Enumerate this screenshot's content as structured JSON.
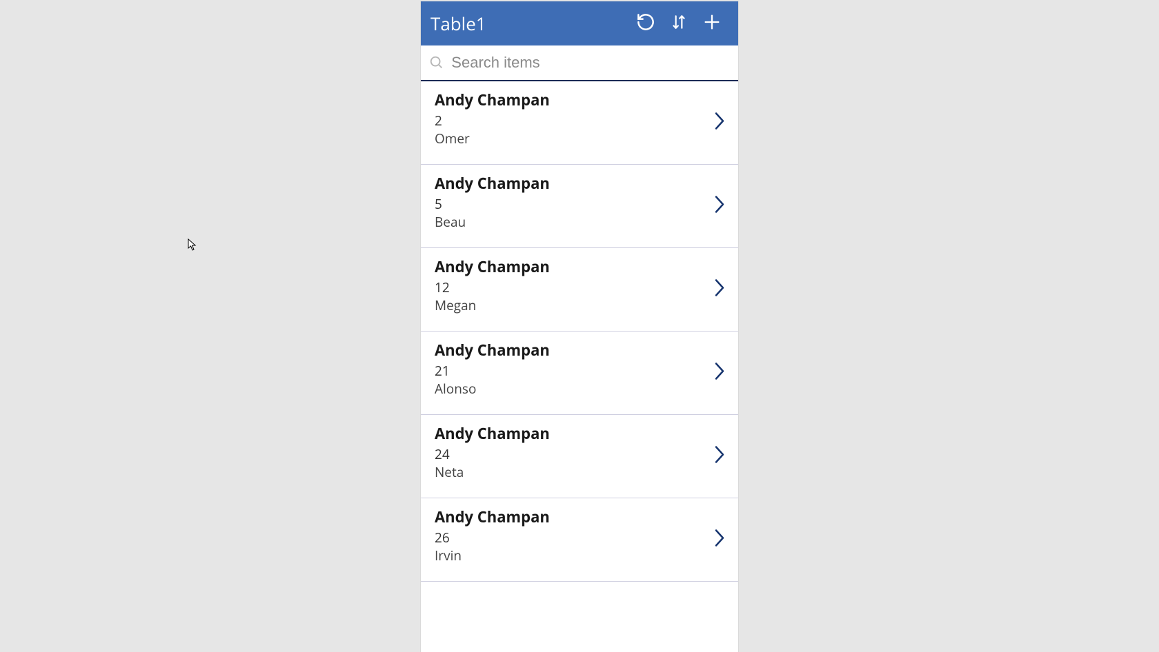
{
  "colors": {
    "accent": "#3e6db5",
    "chevron": "#16346e"
  },
  "header": {
    "title": "Table1"
  },
  "search": {
    "placeholder": "Search items",
    "value": ""
  },
  "items": [
    {
      "title": "Andy Champan",
      "number": "2",
      "name": "Omer"
    },
    {
      "title": "Andy Champan",
      "number": "5",
      "name": "Beau"
    },
    {
      "title": "Andy Champan",
      "number": "12",
      "name": "Megan"
    },
    {
      "title": "Andy Champan",
      "number": "21",
      "name": "Alonso"
    },
    {
      "title": "Andy Champan",
      "number": "24",
      "name": "Neta"
    },
    {
      "title": "Andy Champan",
      "number": "26",
      "name": "Irvin"
    }
  ]
}
